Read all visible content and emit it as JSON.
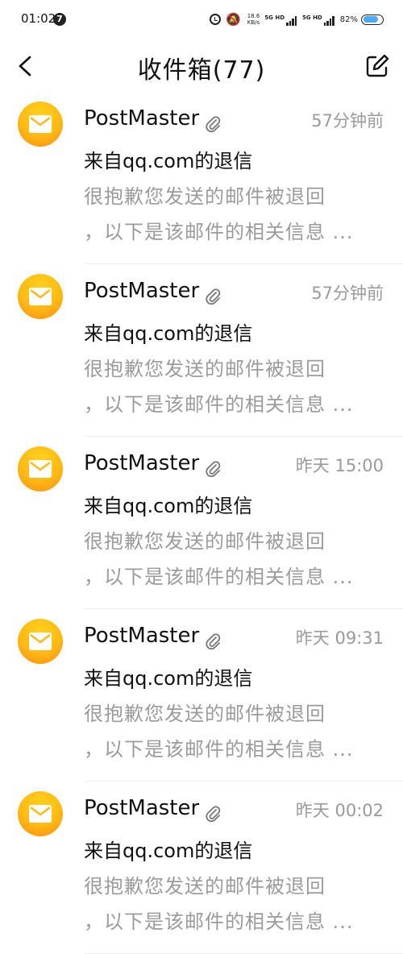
{
  "status_bar": {
    "time": "01:02",
    "notification_badge": "7",
    "net_speed_value": "18.6",
    "net_speed_unit": "KB/s",
    "sim1_label": "5G HD",
    "sim2_label": "5G HD",
    "battery_percent": "82",
    "battery_symbol": "%",
    "battery_level": 0.82,
    "battery_color": "#4fa8f5"
  },
  "header": {
    "title": "收件箱(77)",
    "back_icon": "chevron-left-icon",
    "compose_icon": "edit-icon"
  },
  "mails": [
    {
      "sender": "PostMaster",
      "time": "57分钟前",
      "subject": "来自qq.com的退信",
      "preview_line1": "很抱歉您发送的邮件被退回",
      "preview_line2": "，以下是该邮件的相关信息 ..."
    },
    {
      "sender": "PostMaster",
      "time": "57分钟前",
      "subject": "来自qq.com的退信",
      "preview_line1": "很抱歉您发送的邮件被退回",
      "preview_line2": "，以下是该邮件的相关信息 ..."
    },
    {
      "sender": "PostMaster",
      "time": "昨天 15:00",
      "subject": "来自qq.com的退信",
      "preview_line1": "很抱歉您发送的邮件被退回",
      "preview_line2": "，以下是该邮件的相关信息 ..."
    },
    {
      "sender": "PostMaster",
      "time": "昨天 09:31",
      "subject": "来自qq.com的退信",
      "preview_line1": "很抱歉您发送的邮件被退回",
      "preview_line2": "，以下是该邮件的相关信息 ..."
    },
    {
      "sender": "PostMaster",
      "time": "昨天 00:02",
      "subject": "来自qq.com的退信",
      "preview_line1": "很抱歉您发送的邮件被退回",
      "preview_line2": "，以下是该邮件的相关信息 ..."
    }
  ],
  "colors": {
    "avatar_top": "#ffd21a",
    "avatar_bottom": "#ff8a10",
    "preview_text": "#9c9a9c",
    "time_text": "#9a9a9a"
  }
}
